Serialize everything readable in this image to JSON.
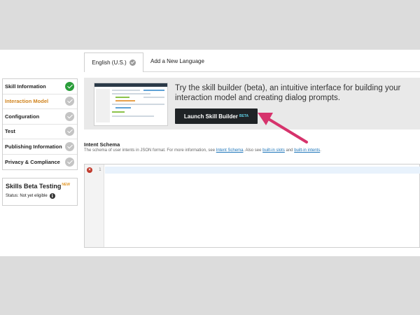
{
  "tabs": {
    "active_label": "English (U.S.)",
    "add_language_label": "Add a New Language"
  },
  "sidebar": {
    "items": [
      {
        "label": "Skill Information",
        "state": "complete"
      },
      {
        "label": "Interaction Model",
        "state": "active"
      },
      {
        "label": "Configuration",
        "state": "pending"
      },
      {
        "label": "Test",
        "state": "pending"
      },
      {
        "label": "Publishing Information",
        "state": "pending"
      },
      {
        "label": "Privacy & Compliance",
        "state": "pending"
      }
    ]
  },
  "beta_testing": {
    "title": "Skills Beta Testing",
    "new_badge": "NEW",
    "status_text": "Status: Not yet eligible",
    "info_icon": "i"
  },
  "banner": {
    "text": "Try the skill builder (beta), an intuitive interface for building your interaction model and creating dialog prompts.",
    "button_label": "Launch Skill Builder",
    "button_badge": "BETA"
  },
  "schema": {
    "title": "Intent Schema",
    "desc_prefix": "The schema of user intents in JSON format. For more information, see ",
    "desc_link1": "Intent Schema",
    "desc_mid": ". Also see ",
    "desc_link2": "built-in slots",
    "desc_and": " and ",
    "desc_link3": "built-in intents",
    "desc_suffix": "."
  },
  "editor": {
    "error_icon": "×",
    "line_number": "1"
  },
  "colors": {
    "active_step": "#d1841f",
    "complete_check": "#2a9d3a",
    "arrow": "#d6336c",
    "button_bg": "#1f2326",
    "beta_badge": "#5fd0e6"
  }
}
